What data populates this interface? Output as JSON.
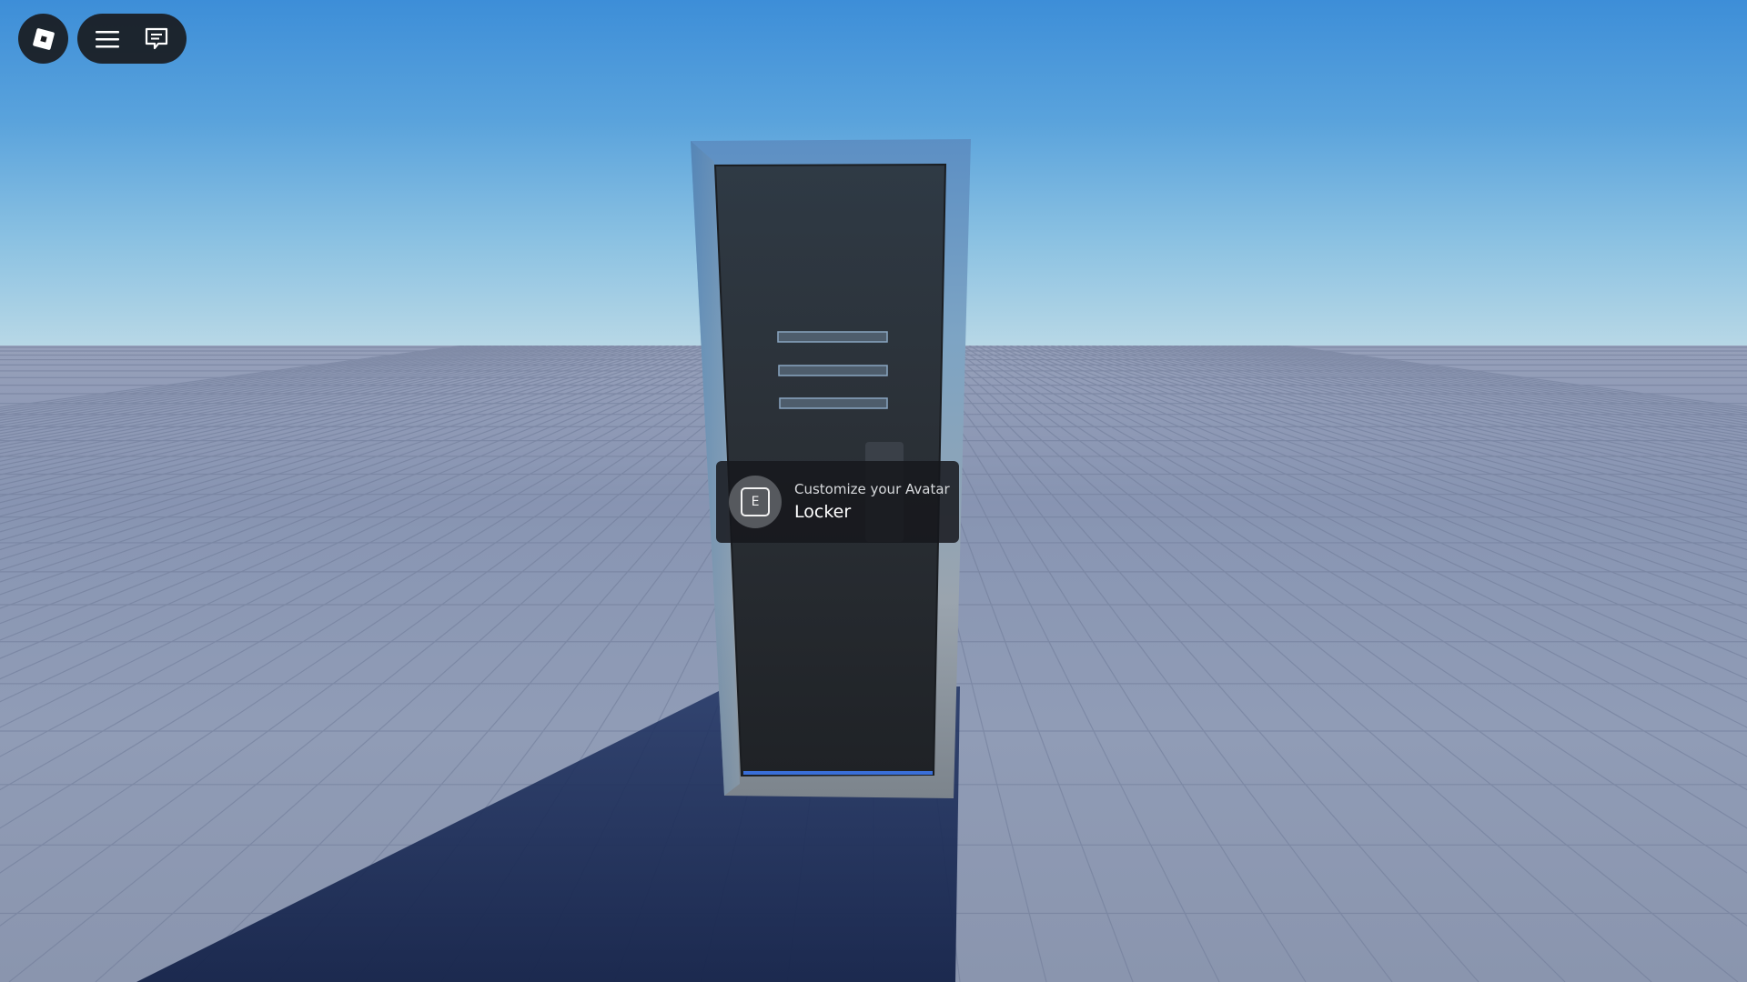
{
  "hud": {
    "logo_icon": "roblox-logo-icon",
    "menu_icon": "hamburger-menu-icon",
    "chat_icon": "chat-bubble-icon"
  },
  "prompt": {
    "key": "E",
    "action_text": "Customize your Avatar",
    "object_text": "Locker"
  },
  "colors": {
    "sky_top": "#3d8ed8",
    "sky_horizon": "#b8d8e6",
    "ground": "#8996b3",
    "hud_bg": "#191b1f",
    "locker_frame": "#8f9cab",
    "locker_door": "#2a2f35"
  }
}
